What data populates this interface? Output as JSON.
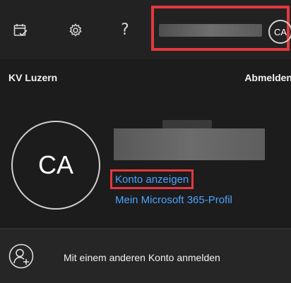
{
  "header": {
    "icons": [
      "calendar-check-icon",
      "gear-icon",
      "help-icon"
    ],
    "help_glyph": "?",
    "avatar_initials": "CA",
    "highlight_color": "#e4383e"
  },
  "account": {
    "org": "KV Luzern",
    "signout": "Abmelden",
    "initials": "CA",
    "view_account": "Konto anzeigen",
    "profile": "Mein Microsoft 365-Profil",
    "link_color": "#4aa3ff"
  },
  "footer": {
    "icon": "add-person-icon",
    "label": "Mit einem anderen Konto anmelden"
  }
}
